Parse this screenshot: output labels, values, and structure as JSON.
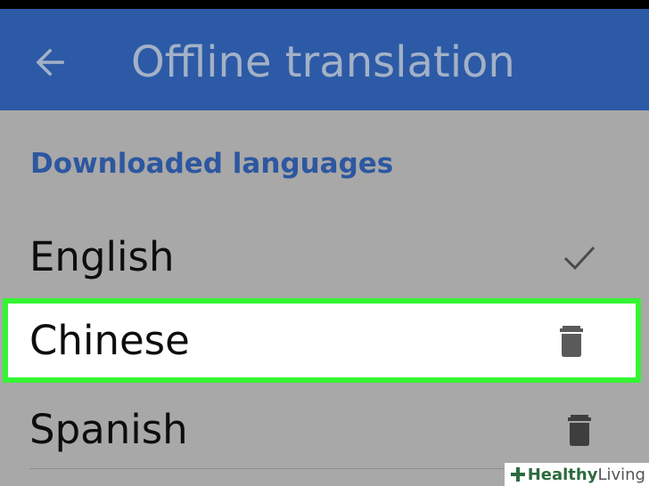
{
  "app_bar": {
    "title": "Offline translation",
    "back_icon": "arrow-left-icon",
    "background": "#2c5aa6"
  },
  "section": {
    "header": "Downloaded languages",
    "header_color": "#2d57a0"
  },
  "languages": [
    {
      "name": "English",
      "action_icon": "checkmark-icon",
      "status": "default"
    },
    {
      "name": "Chinese",
      "action_icon": "trash-icon",
      "highlighted": true
    },
    {
      "name": "Spanish",
      "action_icon": "trash-icon"
    }
  ],
  "highlight_color": "#33f533",
  "watermark": {
    "bold": "Healthy",
    "light": "Living",
    "icon": "plus-cross-icon"
  }
}
